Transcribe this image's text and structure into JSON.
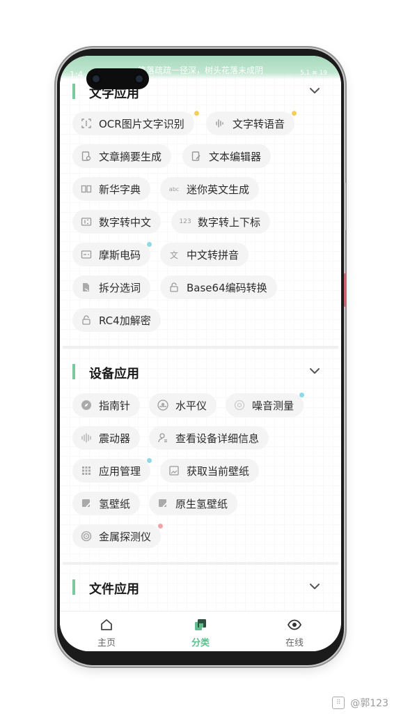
{
  "status_bar": {
    "time": "1:4",
    "quote": "篱落疏疏一径深，树头花落未成阴",
    "icons_text": "5.1 ≋ 19"
  },
  "sections": [
    {
      "title": "文字应用",
      "chips": [
        {
          "label": "OCR图片文字识别",
          "icon": "ocr-icon",
          "dot": "yellow"
        },
        {
          "label": "文字转语音",
          "icon": "voice-wave-icon",
          "dot": "yellow"
        },
        {
          "label": "文章摘要生成",
          "icon": "document-search-icon",
          "dot": ""
        },
        {
          "label": "文本编辑器",
          "icon": "edit-document-icon",
          "dot": ""
        },
        {
          "label": "新华字典",
          "icon": "book-icon",
          "dot": ""
        },
        {
          "label": "迷你英文生成",
          "icon": "abc-icon",
          "dot": ""
        },
        {
          "label": "数字转中文",
          "icon": "number-box-icon",
          "dot": ""
        },
        {
          "label": "数字转上下标",
          "icon": "123-icon",
          "dot": ""
        },
        {
          "label": "摩斯电码",
          "icon": "morse-icon",
          "dot": "blue"
        },
        {
          "label": "中文转拼音",
          "icon": "translate-icon",
          "dot": ""
        },
        {
          "label": "拆分选词",
          "icon": "split-doc-icon",
          "dot": ""
        },
        {
          "label": "Base64编码转换",
          "icon": "lock-icon",
          "dot": ""
        },
        {
          "label": "RC4加解密",
          "icon": "lock-icon",
          "dot": ""
        }
      ]
    },
    {
      "title": "设备应用",
      "chips": [
        {
          "label": "指南针",
          "icon": "compass-icon",
          "dot": ""
        },
        {
          "label": "水平仪",
          "icon": "level-icon",
          "dot": ""
        },
        {
          "label": "噪音测量",
          "icon": "noise-icon",
          "dot": "blue"
        },
        {
          "label": "震动器",
          "icon": "vibration-icon",
          "dot": ""
        },
        {
          "label": "查看设备详细信息",
          "icon": "device-info-icon",
          "dot": ""
        },
        {
          "label": "应用管理",
          "icon": "grid-apps-icon",
          "dot": "blue"
        },
        {
          "label": "获取当前壁纸",
          "icon": "wallpaper-icon",
          "dot": ""
        },
        {
          "label": "氢壁纸",
          "icon": "wallpaper-edit-icon",
          "dot": ""
        },
        {
          "label": "原生氢壁纸",
          "icon": "wallpaper-edit-icon",
          "dot": ""
        },
        {
          "label": "金属探测仪",
          "icon": "radar-icon",
          "dot": "pink"
        }
      ]
    },
    {
      "title": "文件应用",
      "chips": []
    }
  ],
  "nav": [
    {
      "label": "主页",
      "icon": "home-icon",
      "active": false
    },
    {
      "label": "分类",
      "icon": "category-icon",
      "active": true
    },
    {
      "label": "在线",
      "icon": "eye-icon",
      "active": false
    }
  ],
  "watermark": "@郭123",
  "colors": {
    "accent": "#5fbf8c",
    "section_bar": "#7cc9a0",
    "chip_bg": "#f4f4f4",
    "status_bar": "#a7d9bd"
  }
}
